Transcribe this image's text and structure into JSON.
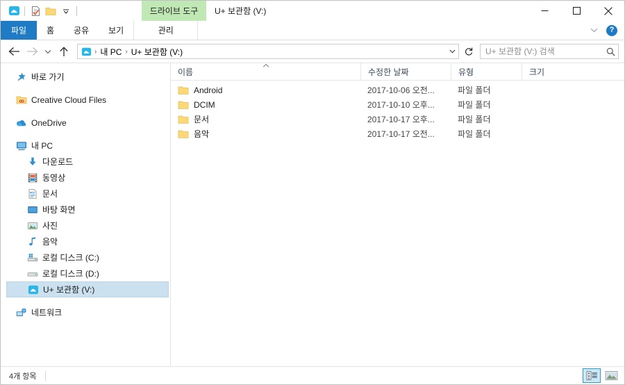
{
  "window": {
    "title": "U+ 보관함 (V:)",
    "contextual_tab_header": "드라이브 도구",
    "quick_access_icons": [
      "drive-cloud-icon",
      "properties-icon",
      "new-folder-icon",
      "customize-chevron-icon"
    ],
    "caption": {
      "minimize": "minimize-button",
      "maximize": "maximize-button",
      "close": "close-button"
    }
  },
  "ribbon": {
    "tabs": [
      {
        "label": "파일",
        "name": "tab-file"
      },
      {
        "label": "홈",
        "name": "tab-home"
      },
      {
        "label": "공유",
        "name": "tab-share"
      },
      {
        "label": "보기",
        "name": "tab-view"
      },
      {
        "label": "관리",
        "name": "tab-manage"
      }
    ],
    "collapse_label": "v",
    "help_label": "?",
    "accent_color": "#1f7cc4",
    "contextual_color": "#bfe8b5"
  },
  "address": {
    "back": "뒤로",
    "forward": "앞으로",
    "recent": "최근 위치",
    "up": "위로",
    "crumbs": [
      "내 PC",
      "U+ 보관함 (V:)"
    ],
    "separator": "›",
    "refresh": "새로 고침"
  },
  "search": {
    "placeholder": "U+ 보관함 (V:) 검색",
    "value": ""
  },
  "sidebar": {
    "items": [
      {
        "label": "바로 가기",
        "icon": "star-pin-icon",
        "depth": 0,
        "name": "sidebar-item-quick-access",
        "selected": false,
        "gap_before": false
      },
      {
        "label": "Creative Cloud Files",
        "icon": "creative-cloud-folder-icon",
        "depth": 0,
        "name": "sidebar-item-creative-cloud-files",
        "selected": false,
        "gap_before": true
      },
      {
        "label": "OneDrive",
        "icon": "onedrive-cloud-icon",
        "depth": 0,
        "name": "sidebar-item-onedrive",
        "selected": false,
        "gap_before": true
      },
      {
        "label": "내 PC",
        "icon": "this-pc-icon",
        "depth": 0,
        "name": "sidebar-item-this-pc",
        "selected": false,
        "gap_before": true
      },
      {
        "label": "다운로드",
        "icon": "downloads-icon",
        "depth": 1,
        "name": "sidebar-item-downloads",
        "selected": false,
        "gap_before": false
      },
      {
        "label": "동영상",
        "icon": "videos-icon",
        "depth": 1,
        "name": "sidebar-item-videos",
        "selected": false,
        "gap_before": false
      },
      {
        "label": "문서",
        "icon": "documents-icon",
        "depth": 1,
        "name": "sidebar-item-documents",
        "selected": false,
        "gap_before": false
      },
      {
        "label": "바탕 화면",
        "icon": "desktop-icon",
        "depth": 1,
        "name": "sidebar-item-desktop",
        "selected": false,
        "gap_before": false
      },
      {
        "label": "사진",
        "icon": "pictures-icon",
        "depth": 1,
        "name": "sidebar-item-pictures",
        "selected": false,
        "gap_before": false
      },
      {
        "label": "음악",
        "icon": "music-icon",
        "depth": 1,
        "name": "sidebar-item-music",
        "selected": false,
        "gap_before": false
      },
      {
        "label": "로컬 디스크 (C:)",
        "icon": "system-drive-icon",
        "depth": 1,
        "name": "sidebar-item-local-disk-c",
        "selected": false,
        "gap_before": false
      },
      {
        "label": "로컬 디스크 (D:)",
        "icon": "drive-icon",
        "depth": 1,
        "name": "sidebar-item-local-disk-d",
        "selected": false,
        "gap_before": false
      },
      {
        "label": "U+ 보관함 (V:)",
        "icon": "cloud-drive-icon",
        "depth": 1,
        "name": "sidebar-item-uplus-drive-v",
        "selected": true,
        "gap_before": false
      },
      {
        "label": "네트워크",
        "icon": "network-icon",
        "depth": 0,
        "name": "sidebar-item-network",
        "selected": false,
        "gap_before": true
      }
    ]
  },
  "filelist": {
    "columns": [
      {
        "label": "이름",
        "name": "column-header-name",
        "sorted": true,
        "sort_dir": "asc"
      },
      {
        "label": "수정한 날짜",
        "name": "column-header-date-modified",
        "sorted": false
      },
      {
        "label": "유형",
        "name": "column-header-type",
        "sorted": false
      },
      {
        "label": "크기",
        "name": "column-header-size",
        "sorted": false
      }
    ],
    "rows": [
      {
        "name": "Android",
        "date": "2017-10-06 오전...",
        "type": "파일 폴더",
        "size": ""
      },
      {
        "name": "DCIM",
        "date": "2017-10-10 오후...",
        "type": "파일 폴더",
        "size": ""
      },
      {
        "name": "문서",
        "date": "2017-10-17 오후...",
        "type": "파일 폴더",
        "size": ""
      },
      {
        "name": "음악",
        "date": "2017-10-17 오전...",
        "type": "파일 폴더",
        "size": ""
      }
    ],
    "folder_color": "#fcd877"
  },
  "statusbar": {
    "item_count": "4개 항목",
    "views": [
      {
        "name": "details-view-button",
        "active": true
      },
      {
        "name": "large-icons-view-button",
        "active": false
      }
    ]
  }
}
